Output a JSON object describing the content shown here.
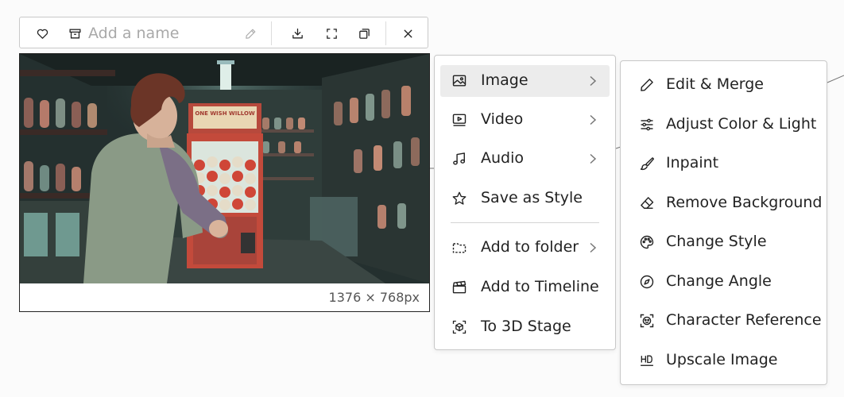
{
  "toolbar": {
    "name_placeholder": "Add a name",
    "name_value": "",
    "icons": [
      "heart-icon",
      "archive-icon",
      "pencil-icon",
      "download-icon",
      "fullscreen-icon",
      "copy-icon",
      "close-icon"
    ]
  },
  "image": {
    "dimensions": "1376 × 768px",
    "sign_text": "ONE WISH WILLOW"
  },
  "menu": {
    "items": [
      {
        "label": "Image",
        "icon": "image-icon",
        "submenu": true,
        "active": true
      },
      {
        "label": "Video",
        "icon": "video-icon",
        "submenu": true
      },
      {
        "label": "Audio",
        "icon": "music-icon",
        "submenu": true
      },
      {
        "label": "Save as Style",
        "icon": "star-icon",
        "submenu": false
      },
      {
        "label": "Add to folder",
        "icon": "folder-icon",
        "submenu": true
      },
      {
        "label": "Add to Timeline",
        "icon": "clapperboard-icon",
        "submenu": false
      },
      {
        "label": "To 3D Stage",
        "icon": "cube-icon",
        "submenu": false
      }
    ]
  },
  "submenu": {
    "items": [
      {
        "label": "Edit & Merge",
        "icon": "pencil-icon"
      },
      {
        "label": "Adjust Color & Light",
        "icon": "sliders-icon"
      },
      {
        "label": "Inpaint",
        "icon": "brush-icon"
      },
      {
        "label": "Remove Background",
        "icon": "eraser-icon"
      },
      {
        "label": "Change Style",
        "icon": "palette-icon"
      },
      {
        "label": "Change Angle",
        "icon": "compass-icon"
      },
      {
        "label": "Character Reference",
        "icon": "face-scan-icon"
      },
      {
        "label": "Upscale Image",
        "icon": "hd-icon"
      }
    ]
  },
  "colors": {
    "menu_active_bg": "#ececec",
    "border": "#c8c8c8"
  }
}
